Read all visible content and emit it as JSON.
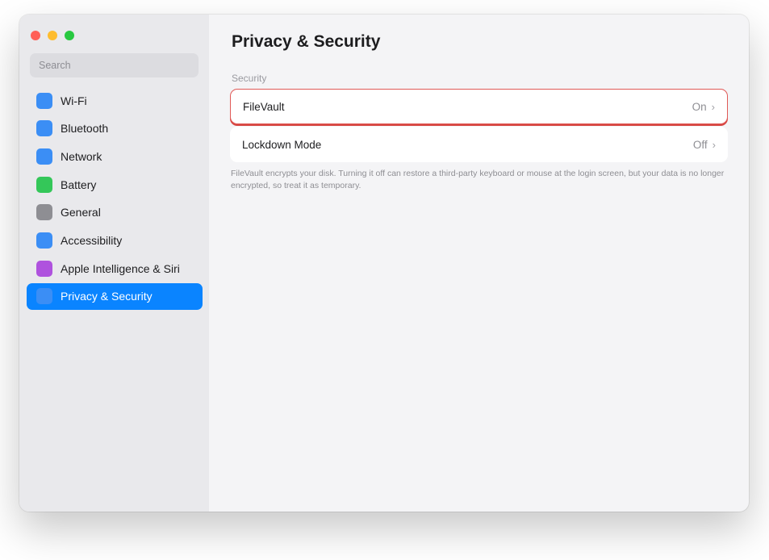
{
  "window": {
    "traffic_lights": [
      "close",
      "minimize",
      "zoom"
    ]
  },
  "sidebar": {
    "search": {
      "placeholder": "Search",
      "value": ""
    },
    "items": [
      {
        "label": "Wi-Fi",
        "icon": "wifi-icon",
        "color": "#3b8ef5",
        "selected": false
      },
      {
        "label": "Bluetooth",
        "icon": "bluetooth-icon",
        "color": "#3b8ef5",
        "selected": false
      },
      {
        "label": "Network",
        "icon": "network-icon",
        "color": "#3b8ef5",
        "selected": false
      },
      {
        "label": "Battery",
        "icon": "battery-icon",
        "color": "#34c759",
        "selected": false
      },
      {
        "label": "General",
        "icon": "gear-icon",
        "color": "#8e8e93",
        "selected": false
      },
      {
        "label": "Accessibility",
        "icon": "accessibility-icon",
        "color": "#3b8ef5",
        "selected": false
      },
      {
        "label": "Apple Intelligence & Siri",
        "icon": "siri-icon",
        "color": "#af52de",
        "selected": false
      },
      {
        "label": "Privacy & Security",
        "icon": "hand-icon",
        "color": "#3b8ef5",
        "selected": true
      }
    ]
  },
  "main": {
    "title": "Privacy & Security",
    "section_label": "Security",
    "rows": [
      {
        "label": "FileVault",
        "value": "On",
        "highlighted": true
      },
      {
        "label": "Lockdown Mode",
        "value": "Off",
        "highlighted": false
      }
    ],
    "footnote": "FileVault encrypts your disk. Turning it off can restore a third-party keyboard or mouse at the login screen, but your data is no longer encrypted, so treat it as temporary."
  },
  "colors": {
    "accent": "#0a84ff",
    "highlight_border": "#e05a57"
  }
}
